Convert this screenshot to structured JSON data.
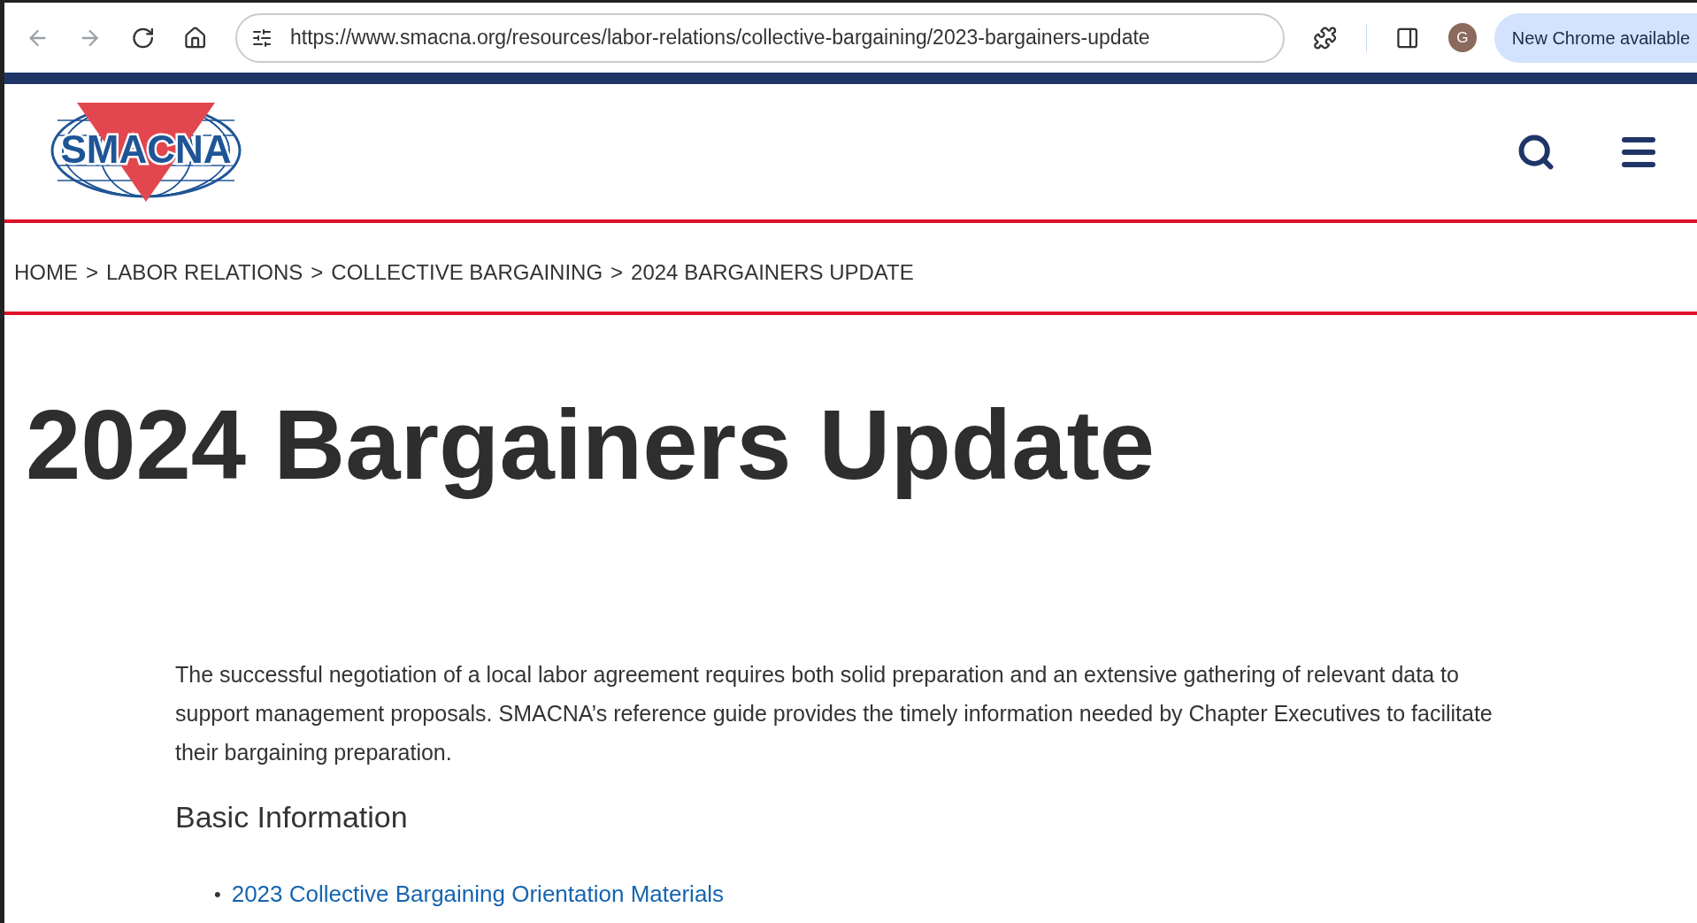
{
  "browser": {
    "url": "https://www.smacna.org/resources/labor-relations/collective-bargaining/2023-bargainers-update",
    "profile_initial": "G",
    "update_chip": "New Chrome available"
  },
  "header": {
    "logo_text": "SMACNA"
  },
  "breadcrumb": [
    "HOME",
    ">",
    "LABOR RELATIONS",
    ">",
    "COLLECTIVE BARGAINING",
    ">",
    "2024 BARGAINERS UPDATE"
  ],
  "title": "2024 Bargainers Update",
  "intro": "The successful negotiation of a local labor agreement requires both solid preparation and an extensive gathering of relevant data to support management proposals. SMACNA’s reference guide provides the timely information needed by Chapter Executives to facilitate their bargaining preparation.",
  "sections": [
    {
      "heading": "Basic Information",
      "links": [
        {
          "bullet": "•",
          "label": "2023 Collective Bargaining Orientation Materials"
        }
      ]
    }
  ]
}
